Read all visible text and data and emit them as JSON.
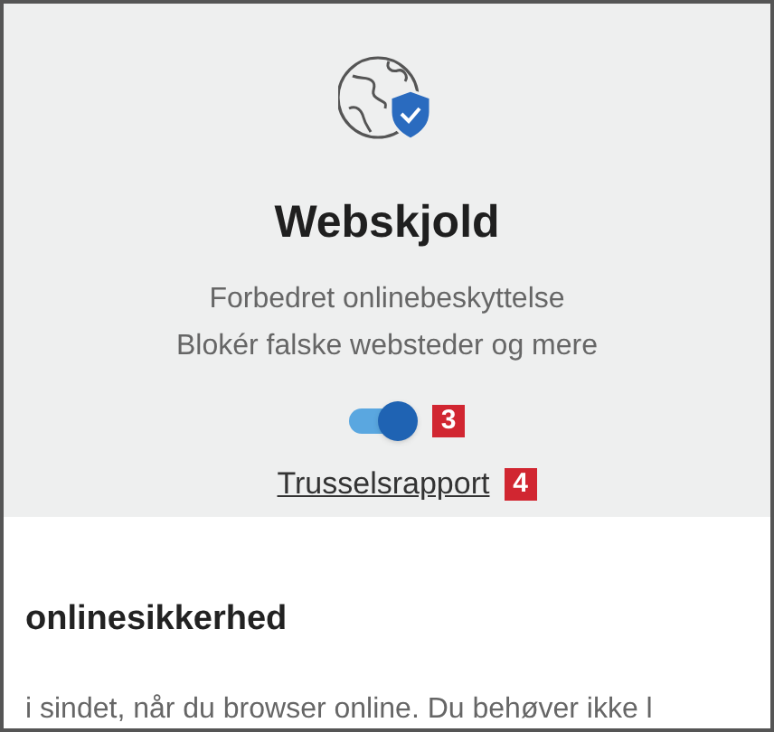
{
  "shield": {
    "title": "Webskjold",
    "subtitle_lines": [
      "Forbedret onlinebeskyttelse",
      "Blokér falske websteder og mere"
    ],
    "toggle": {
      "on": true,
      "callout": "3"
    },
    "link": {
      "label": "Trusselsrapport",
      "callout": "4"
    }
  },
  "section": {
    "heading": "onlinesikkerhed",
    "text": "i sindet, når du browser online. Du behøver ikke l"
  }
}
